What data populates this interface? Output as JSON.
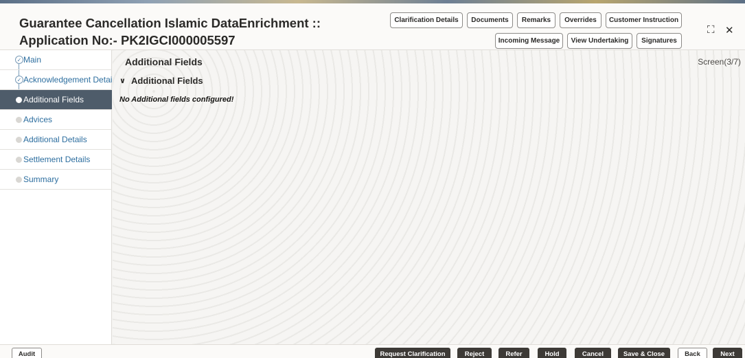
{
  "header": {
    "title_line1": "Guarantee Cancellation Islamic DataEnrichment ::",
    "title_line2": "Application No:- PK2IGCI000005597",
    "buttons_row1": [
      "Clarification Details",
      "Documents",
      "Remarks",
      "Overrides",
      "Customer Instruction"
    ],
    "buttons_row2": [
      "Incoming Message",
      "View Undertaking",
      "Signatures"
    ],
    "expand_glyph": "⛶",
    "close_glyph": "✕"
  },
  "sidebar": {
    "items": [
      {
        "label": "Main",
        "state": "done"
      },
      {
        "label": "Acknowledgement Details",
        "state": "done"
      },
      {
        "label": "Additional Fields",
        "state": "active"
      },
      {
        "label": "Advices",
        "state": "pending"
      },
      {
        "label": "Additional Details",
        "state": "pending"
      },
      {
        "label": "Settlement Details",
        "state": "pending"
      },
      {
        "label": "Summary",
        "state": "pending"
      }
    ]
  },
  "main": {
    "title": "Additional Fields",
    "screen_count": "Screen(3/7)",
    "section_title": "Additional Fields",
    "empty_message": "No Additional fields configured!"
  },
  "footer": {
    "audit": "Audit",
    "actions": [
      "Request Clarification",
      "Reject",
      "Refer",
      "Hold",
      "Cancel",
      "Save & Close"
    ],
    "back": "Back",
    "next": "Next"
  },
  "colors": {
    "active_sidebar": "#4e5c6a",
    "link_blue": "#2d6e9f",
    "dark_button": "#3d3a36"
  }
}
